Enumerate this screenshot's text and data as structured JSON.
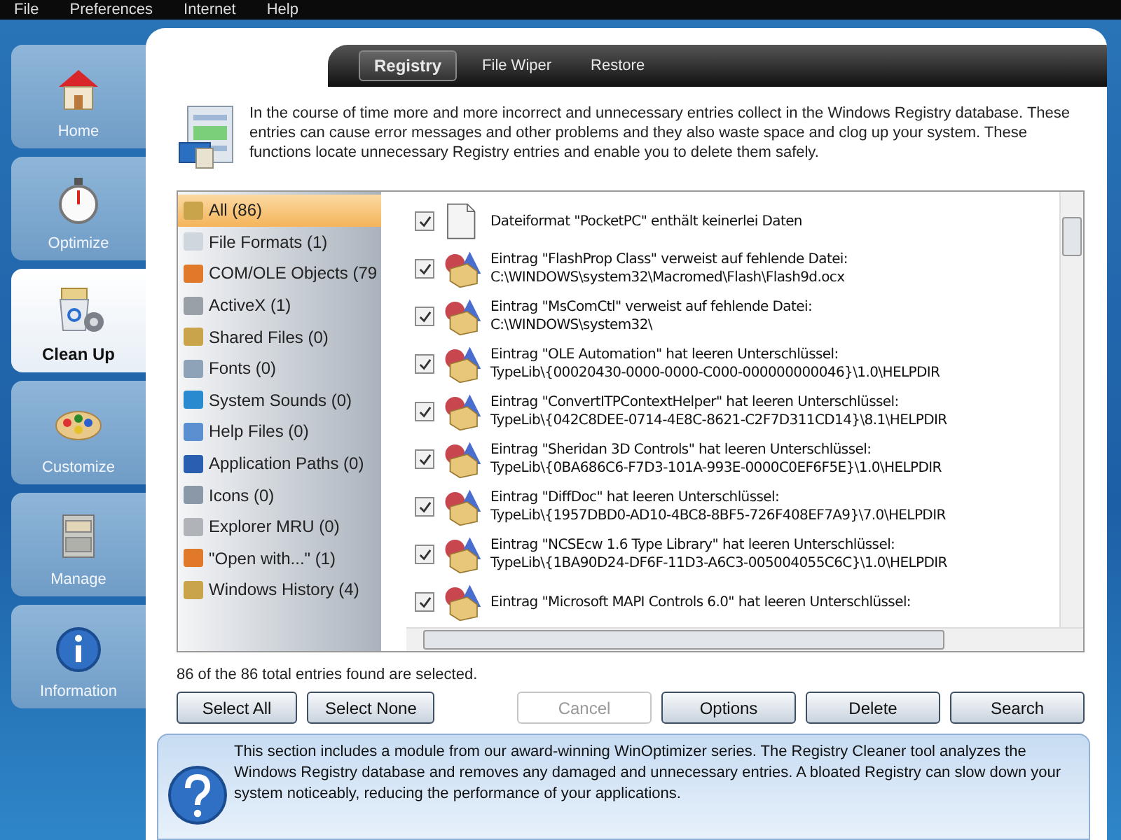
{
  "menu": [
    "File",
    "Preferences",
    "Internet",
    "Help"
  ],
  "sidebar": [
    {
      "label": "Home",
      "kind": "house",
      "selected": false
    },
    {
      "label": "Optimize",
      "kind": "stopwatch",
      "selected": false
    },
    {
      "label": "Clean Up",
      "kind": "cleanup",
      "selected": true
    },
    {
      "label": "Customize",
      "kind": "palette",
      "selected": false
    },
    {
      "label": "Manage",
      "kind": "cabinet",
      "selected": false
    },
    {
      "label": "Information",
      "kind": "info",
      "selected": false
    }
  ],
  "tabs": [
    {
      "label": "Registry",
      "selected": true
    },
    {
      "label": "File Wiper",
      "selected": false
    },
    {
      "label": "Restore",
      "selected": false
    }
  ],
  "intro": "In the course of time more and more incorrect and unnecessary entries collect in the Windows Registry database. These entries can cause error messages and other problems and they also waste space and clog up your system. These functions locate unnecessary Registry entries and enable you to delete them safely.",
  "categories": [
    {
      "label": "All (86)",
      "selected": true
    },
    {
      "label": "File Formats (1)",
      "selected": false
    },
    {
      "label": "COM/OLE Objects (79",
      "selected": false
    },
    {
      "label": "ActiveX (1)",
      "selected": false
    },
    {
      "label": "Shared Files (0)",
      "selected": false
    },
    {
      "label": "Fonts (0)",
      "selected": false
    },
    {
      "label": "System Sounds (0)",
      "selected": false
    },
    {
      "label": "Help Files (0)",
      "selected": false
    },
    {
      "label": "Application Paths (0)",
      "selected": false
    },
    {
      "label": "Icons (0)",
      "selected": false
    },
    {
      "label": "Explorer MRU (0)",
      "selected": false
    },
    {
      "label": "\"Open with...\" (1)",
      "selected": false
    },
    {
      "label": "Windows History (4)",
      "selected": false
    }
  ],
  "entries": [
    {
      "kind": "file",
      "checked": true,
      "lines": [
        "Dateiformat \"PocketPC\" enthält keinerlei Daten"
      ]
    },
    {
      "kind": "registry",
      "checked": true,
      "lines": [
        "Eintrag \"FlashProp Class\" verweist auf fehlende Datei:",
        "C:\\WINDOWS\\system32\\Macromed\\Flash\\Flash9d.ocx"
      ]
    },
    {
      "kind": "registry",
      "checked": true,
      "lines": [
        "Eintrag \"MsComCtl\" verweist auf fehlende Datei:",
        "C:\\WINDOWS\\system32\\"
      ]
    },
    {
      "kind": "registry",
      "checked": true,
      "lines": [
        "Eintrag \"OLE Automation\" hat leeren Unterschlüssel:",
        "TypeLib\\{00020430-0000-0000-C000-000000000046}\\1.0\\HELPDIR"
      ]
    },
    {
      "kind": "registry",
      "checked": true,
      "lines": [
        "Eintrag \"ConvertITPContextHelper\" hat leeren Unterschlüssel:",
        "TypeLib\\{042C8DEE-0714-4E8C-8621-C2F7D311CD14}\\8.1\\HELPDIR"
      ]
    },
    {
      "kind": "registry",
      "checked": true,
      "lines": [
        "Eintrag \"Sheridan 3D Controls\" hat leeren Unterschlüssel:",
        "TypeLib\\{0BA686C6-F7D3-101A-993E-0000C0EF6F5E}\\1.0\\HELPDIR"
      ]
    },
    {
      "kind": "registry",
      "checked": true,
      "lines": [
        "Eintrag \"DiffDoc\" hat leeren Unterschlüssel:",
        "TypeLib\\{1957DBD0-AD10-4BC8-8BF5-726F408EF7A9}\\7.0\\HELPDIR"
      ]
    },
    {
      "kind": "registry",
      "checked": true,
      "lines": [
        "Eintrag \"NCSEcw 1.6 Type Library\" hat leeren Unterschlüssel:",
        "TypeLib\\{1BA90D24-DF6F-11D3-A6C3-005004055C6C}\\1.0\\HELPDIR"
      ]
    },
    {
      "kind": "registry",
      "checked": true,
      "lines": [
        "Eintrag \"Microsoft MAPI Controls 6.0\" hat leeren Unterschlüssel:"
      ]
    }
  ],
  "status": "86 of the 86 total entries found are selected.",
  "buttons_left": [
    {
      "label": "Select All",
      "disabled": false
    },
    {
      "label": "Select None",
      "disabled": false
    }
  ],
  "buttons_right": [
    {
      "label": "Cancel",
      "disabled": true
    },
    {
      "label": "Options",
      "disabled": false
    },
    {
      "label": "Delete",
      "disabled": false
    },
    {
      "label": "Search",
      "disabled": false
    }
  ],
  "info": "This section includes a module from our award-winning WinOptimizer series. The Registry Cleaner tool analyzes the Windows Registry database and removes any damaged and unnecessary entries. A bloated Registry can slow down your system noticeably, reducing the performance of your applications."
}
